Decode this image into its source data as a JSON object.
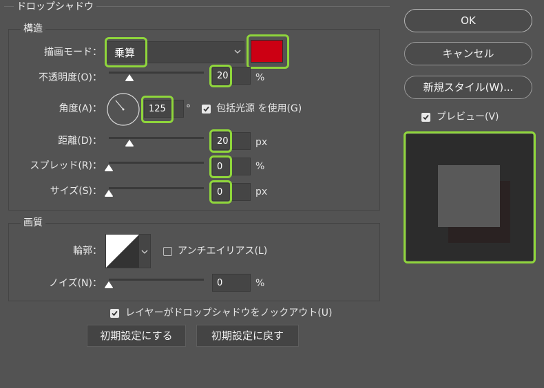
{
  "dialog": {
    "section_title": "ドロップシャドウ",
    "structure": {
      "legend": "構造",
      "blend_mode_label": "描画モード：",
      "blend_mode_value": "乗算",
      "shadow_color": "#cc0013",
      "opacity_label": "不透明度(O)：",
      "opacity_value": "20",
      "opacity_unit": "%",
      "angle_label": "角度(A)：",
      "angle_value": "125",
      "angle_unit": "°",
      "global_light_label": "包括光源 を使用(G)",
      "global_light_checked": true,
      "distance_label": "距離(D)：",
      "distance_value": "20",
      "distance_unit": "px",
      "spread_label": "スプレッド(R)：",
      "spread_value": "0",
      "spread_unit": "%",
      "size_label": "サイズ(S)：",
      "size_value": "0",
      "size_unit": "px"
    },
    "quality": {
      "legend": "画質",
      "contour_label": "輪郭：",
      "antialias_label": "アンチエイリアス(L)",
      "antialias_checked": false,
      "noise_label": "ノイズ(N)：",
      "noise_value": "0",
      "noise_unit": "%"
    },
    "knockout_label": "レイヤーがドロップシャドウをノックアウト(U)",
    "knockout_checked": true,
    "make_default_button": "初期設定にする",
    "reset_default_button": "初期設定に戻す"
  },
  "side": {
    "ok_button": "OK",
    "cancel_button": "キャンセル",
    "new_style_button": "新規スタイル(W)...",
    "preview_label": "プレビュー(V)",
    "preview_checked": true
  },
  "colors": {
    "highlight": "#8fd63b",
    "background": "#535353",
    "field": "#454545",
    "shadow_color": "#cc0013"
  }
}
